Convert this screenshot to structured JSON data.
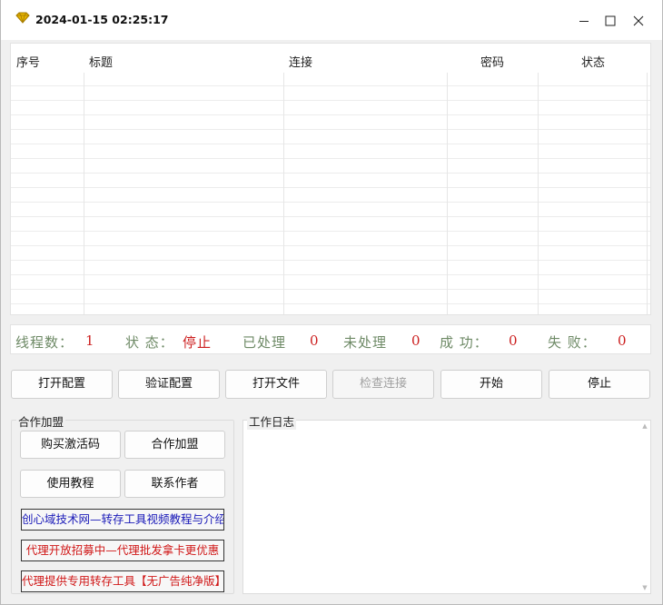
{
  "window": {
    "title": "2024-01-15 02:25:17",
    "accent": "#d9a400"
  },
  "grid": {
    "columns": [
      "序号",
      "标题",
      "连接",
      "密码",
      "状态"
    ]
  },
  "stats": {
    "threads_label": "线程数：",
    "threads_value": "1",
    "status_label": "状 态：",
    "status_value": "停止",
    "processed_label": "已处理",
    "processed_value": "0",
    "unprocessed_label": "未处理",
    "unprocessed_value": "0",
    "success_label": "成 功：",
    "success_value": "0",
    "fail_label": "失 败：",
    "fail_value": "0",
    "label_color": "#6e8a66",
    "value_color": "#cc1f1f"
  },
  "actions": {
    "open_config": "打开配置",
    "verify_config": "验证配置",
    "open_file": "打开文件",
    "check_link": "检查连接",
    "start": "开始",
    "stop": "停止"
  },
  "cooperation": {
    "title": "合作加盟",
    "buy_code": "购买激活码",
    "join": "合作加盟",
    "tutorial": "使用教程",
    "contact": "联系作者",
    "link1": "创心域技术网—转存工具视频教程与介绍",
    "link1_color": "#1a1ab8",
    "link2": "代理开放招募中—代理批发拿卡更优惠",
    "link2_color": "#d01818",
    "link3": "代理提供专用转存工具【无广告纯净版】",
    "link3_color": "#d01818"
  },
  "log": {
    "title": "工作日志"
  }
}
